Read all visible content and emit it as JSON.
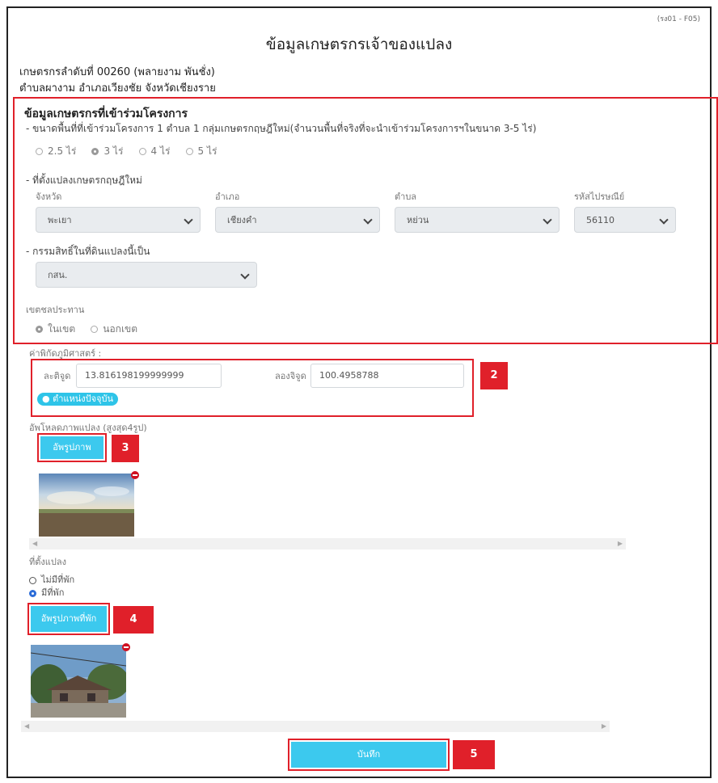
{
  "form_code": "(รง01 - F05)",
  "page_title": "ข้อมูลเกษตรกรเจ้าของแปลง",
  "farmer": {
    "line1": "เกษตรกรลำดับที่ 00260 (พลายงาม พันชั่ง)",
    "line2": "ตำบลผางาม อำเภอเวียงชัย จังหวัดเชียงราย"
  },
  "participation": {
    "title": "ข้อมูลเกษตรกรที่เข้าร่วมโครงการ",
    "area_label": "- ขนาดพื้นที่ที่เข้าร่วมโครงการ 1 ตำบล 1 กลุ่มเกษตรกฤษฎีใหม่(จำนวนพื้นที่จริงที่จะนำเข้าร่วมโครงการฯในขนาด 3-5 ไร่)",
    "area_options": [
      "2.5 ไร่",
      "3 ไร่",
      "4 ไร่",
      "5 ไร่"
    ],
    "area_selected": "3 ไร่",
    "location_label": "- ที่ตั้งแปลงเกษตรกฤษฎีใหม่",
    "province_label": "จังหวัด",
    "province_value": "พะเยา",
    "district_label": "อำเภอ",
    "district_value": "เชียงคำ",
    "subdistrict_label": "ตำบล",
    "subdistrict_value": "หย่วน",
    "postcode_label": "รหัสไปรษณีย์",
    "postcode_value": "56110",
    "ownership_label": "- กรรมสิทธิ์ในที่ดินแปลงนี้เป็น",
    "ownership_value": "กสน.",
    "irrigation_label": "เขตชลประทาน",
    "irrigation_options": [
      "ในเขต",
      "นอกเขต"
    ],
    "irrigation_selected": "ในเขต"
  },
  "coordinates": {
    "label": "ค่าพิกัดภูมิศาสตร์ :",
    "lat_label": "ละติจูด",
    "lat_value": "13.816198199999999",
    "lng_label": "ลองจิจูด",
    "lng_value": "100.4958788",
    "current_location_button": "ตำแหน่งปัจจุบัน"
  },
  "plot_photos": {
    "label": "อัพโหลดภาพแปลง (สูงสุด4รูป)",
    "upload_button": "อัพรูปภาพ"
  },
  "rest_area": {
    "label": "ที่ตั้งแปลง",
    "options": [
      "ไม่มีที่พัก",
      "มีที่พัก"
    ],
    "selected": "มีที่พัก",
    "upload_button": "อัพรูปภาพที่พัก"
  },
  "save_button": "บันทึก",
  "callouts": [
    "2",
    "3",
    "4",
    "5"
  ],
  "colors": {
    "highlight_border": "#e0202a",
    "button": "#3cc9ee",
    "callout_bg": "#e0202a"
  }
}
